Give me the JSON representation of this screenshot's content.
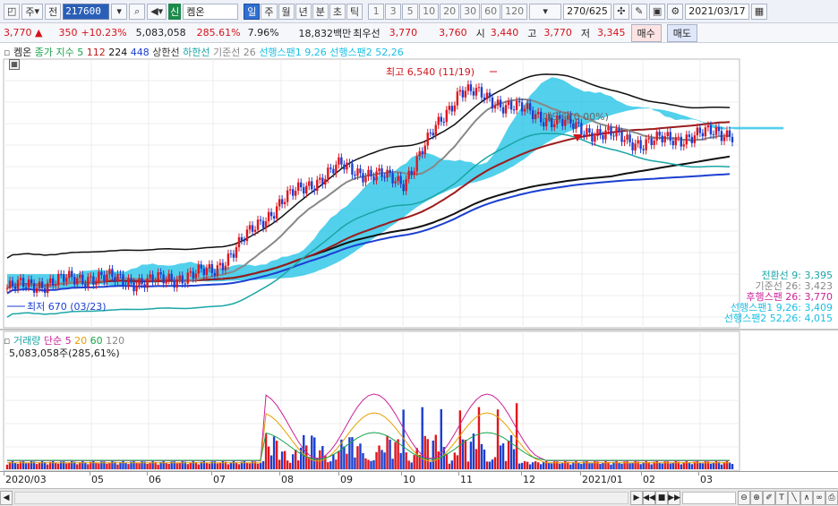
{
  "toolbar": {
    "period_label": "주",
    "all_label": "전",
    "code": "217600",
    "sin_badge": "신",
    "name": "켐온",
    "periods": [
      "일",
      "주",
      "월",
      "년",
      "분",
      "초",
      "틱"
    ],
    "periods_selected": "일",
    "nums": [
      "1",
      "3",
      "5",
      "10",
      "20",
      "30",
      "60",
      "120"
    ],
    "count": "270",
    "total": "/625",
    "date": "2021/03/17"
  },
  "quote": {
    "price": "3,770",
    "change": "350",
    "change_pct": "+10.23%",
    "volume": "5,083,058",
    "vol_ratio": "285.61%",
    "turnover": "7.96%",
    "amount": "18,832백만",
    "pref_label": "최우선",
    "pref_ask": "3,770",
    "pref_bid": "3,760",
    "open_label": "시",
    "open": "3,440",
    "high_label": "고",
    "high": "3,770",
    "low_label": "저",
    "low": "3,345",
    "buy_label": "매수",
    "sell_label": "매도"
  },
  "legend": {
    "name": "켐온",
    "ma_label": "종가 지수 5",
    "ma112": "112",
    "ma224": "224",
    "ma448": "448",
    "upper": "상한선",
    "lower": "하한선",
    "base": "기준선 26",
    "span1": "선행스팬1 9,26",
    "span2": "선행스팬2 52,26"
  },
  "annotations": {
    "high": "최고 6,540 (11/19)",
    "low": "최저 670 (03/23)",
    "cross": "데드락(0.00%)"
  },
  "right_labels": [
    {
      "text": "전환선 9: 3,395",
      "color": "#1aa5a5"
    },
    {
      "text": "기준선 26: 3,423",
      "color": "#888888"
    },
    {
      "text": "후행스팬 26: 3,770",
      "color": "#cc2299"
    },
    {
      "text": "선행스팬1 9,26: 3,409",
      "color": "#19c0e6"
    },
    {
      "text": "선행스팬2 52,26: 4,015",
      "color": "#19c0e6"
    }
  ],
  "volume_legend": {
    "label": "거래량",
    "ma_label": "단순 5",
    "ma20": "20",
    "ma60": "60",
    "ma120": "120",
    "value": "5,083,058주(285,61%)"
  },
  "x_labels": [
    "2020/03",
    "05",
    "06",
    "07",
    "08",
    "09",
    "10",
    "11",
    "12",
    "2021/01",
    "02",
    "03"
  ],
  "colors": {
    "up": "#e0161e",
    "down": "#1b3fd1",
    "cloud": "#19c0e6"
  },
  "chart_data": {
    "type": "candlestick",
    "x": [
      "2020/03",
      "2020/05",
      "2020/06",
      "2020/07",
      "2020/08",
      "2020/09",
      "2020/10",
      "2020/11",
      "2020/12",
      "2021/01",
      "2021/02",
      "2021/03"
    ],
    "close": [
      800,
      900,
      850,
      950,
      1900,
      2700,
      2300,
      5800,
      4700,
      3900,
      3400,
      3770
    ],
    "high": 6540,
    "low": 670
  }
}
